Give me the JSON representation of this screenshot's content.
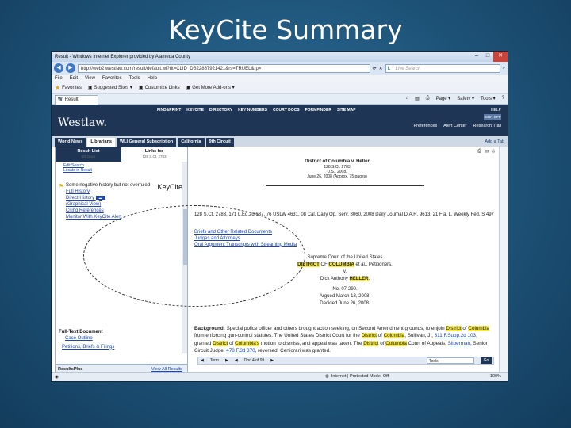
{
  "slide": {
    "title": "KeyCite Summary"
  },
  "browser": {
    "window_title": "Result - Windows Internet Explorer provided by Alameda County",
    "url": "http://web2.westlaw.com/result/default.wl?rlt=CLID_DB22867921421&rs=TRUEL&rp=",
    "search_placeholder": "Live Search",
    "menu": [
      "File",
      "Edit",
      "View",
      "Favorites",
      "Tools",
      "Help"
    ],
    "favorites": [
      "Favorites",
      "Suggested Sites ▾",
      "Customize Links",
      "Get More Add-ons ▾"
    ],
    "tab_label": "Result",
    "tools": [
      "Page ▾",
      "Safety ▾",
      "Tools ▾",
      "?"
    ],
    "status_zone": "Internet | Protected Mode: Off",
    "zoom": "100%"
  },
  "westlaw": {
    "logo": "Westlaw.",
    "topnav": [
      "FIND&PRINT",
      "KEYCITE",
      "DIRECTORY",
      "KEY NUMBERS",
      "COURT DOCS",
      "FORMFINDER",
      "SITE MAP"
    ],
    "toplinks": [
      "Preferences",
      "Alert Center",
      "Research Trail"
    ],
    "help": "HELP",
    "signoff": "SIGN OFF",
    "tabs": [
      "World News",
      "Librarians",
      "WLI General Subscription",
      "California",
      "9th Circuit"
    ],
    "add_tab": "Add a Tab"
  },
  "left": {
    "tab_results": "Result List",
    "tab_results_sub": "5/5 Docs",
    "tab_links": "Links for",
    "tab_links_sub": "128 S.Ct. 2783",
    "edit_search": "Edit Search",
    "locate": "Locate in Result",
    "kc_warning": "Some negative history but not overruled",
    "kc_logo": "KeyCite",
    "links": [
      "Full History",
      "Direct History",
      "(Graphical View)",
      "Citing References",
      "Monitor With KeyCite Alert"
    ],
    "full_text": "Full-Text Document",
    "case_outline": "Case Outline",
    "petitions": "Petitions, Briefs & Filings",
    "results_plus": "ResultsPlus",
    "view_all": "View All Results"
  },
  "doc": {
    "title": "District of Columbia v. Heller",
    "cite_line1": "128 S.Ct. 2783",
    "cite_line2": "U.S., 2008.",
    "cite_line3": "June 26, 2008 (Approx. 75 pages)",
    "parallel": "128 S.Ct. 2783, 171 L.Ed.2d 637, 76 USLW 4631, 08 Cal. Daily Op. Serv. 8060, 2008 Daily Journal D.A.R. 9613, 21 Fla. L. Weekly Fed. S 497",
    "links": [
      "Briefs and Other Related Documents",
      "Judges and Attorneys",
      "Oral Argument Transcripts with Streaming Media"
    ],
    "court": "Supreme Court of the United States",
    "party1a": "DISTRICT",
    "party1b": " OF ",
    "party1c": "COLUMBIA",
    "party1d": " et al., Petitioners,",
    "versus": "v.",
    "party2a": "Dick Anthony ",
    "party2b": "HELLER",
    "party2c": ".",
    "docket": "No. 07-290.",
    "argued": "Argued March 18, 2008.",
    "decided": "Decided June 26, 2008.",
    "footer_term": "Term",
    "footer_doc": "Doc 4 of 99",
    "footer_tools": "Tools",
    "footer_go": "Go"
  }
}
